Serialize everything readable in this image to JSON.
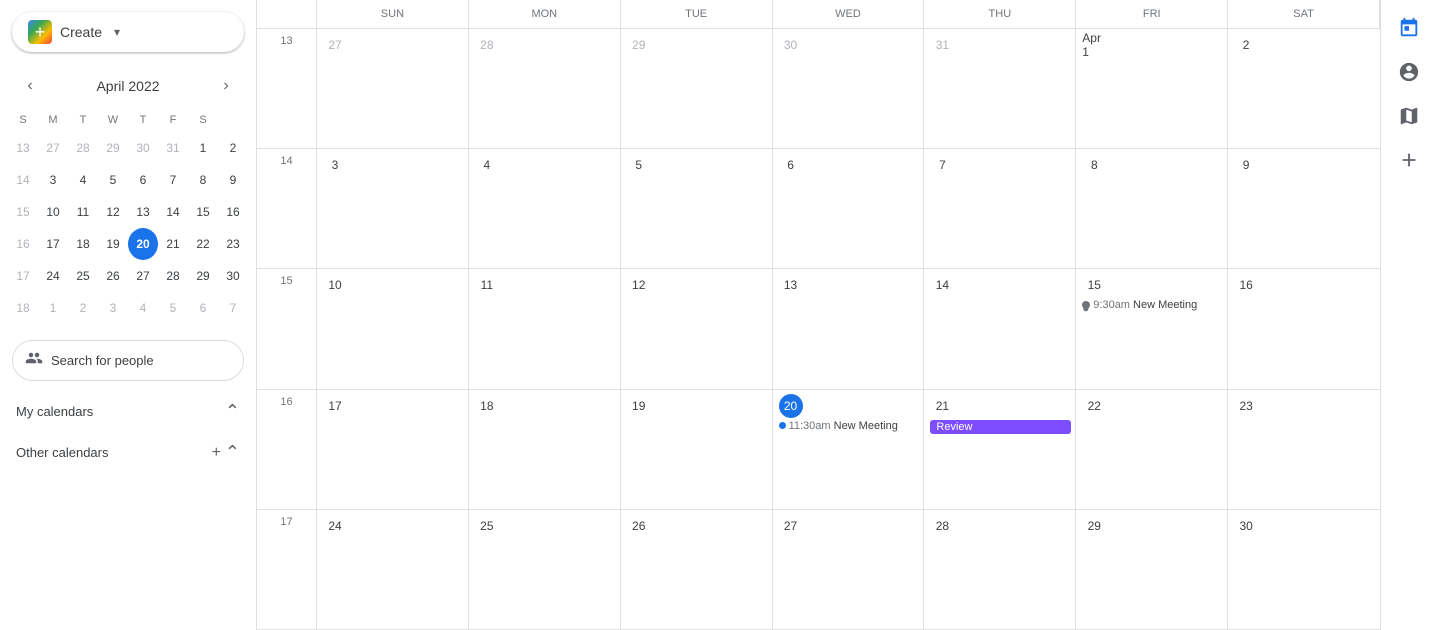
{
  "sidebar": {
    "create_button": "Create",
    "mini_cal": {
      "title": "April 2022",
      "days_of_week": [
        "S",
        "M",
        "T",
        "W",
        "T",
        "F",
        "S"
      ],
      "weeks": [
        [
          {
            "num": "13",
            "type": "other"
          },
          {
            "num": "27",
            "type": "other"
          },
          {
            "num": "28",
            "type": "other"
          },
          {
            "num": "29",
            "type": "other"
          },
          {
            "num": "30",
            "type": "other"
          },
          {
            "num": "31",
            "type": "other"
          },
          {
            "num": "1",
            "type": "normal"
          },
          {
            "num": "2",
            "type": "normal"
          }
        ],
        [
          {
            "num": "14",
            "type": "other"
          },
          {
            "num": "3",
            "type": "normal"
          },
          {
            "num": "4",
            "type": "normal"
          },
          {
            "num": "5",
            "type": "normal"
          },
          {
            "num": "6",
            "type": "normal"
          },
          {
            "num": "7",
            "type": "normal"
          },
          {
            "num": "8",
            "type": "normal"
          },
          {
            "num": "9",
            "type": "normal"
          }
        ],
        [
          {
            "num": "15",
            "type": "other"
          },
          {
            "num": "10",
            "type": "normal"
          },
          {
            "num": "11",
            "type": "normal"
          },
          {
            "num": "12",
            "type": "normal"
          },
          {
            "num": "13",
            "type": "normal"
          },
          {
            "num": "14",
            "type": "normal"
          },
          {
            "num": "15",
            "type": "normal"
          },
          {
            "num": "16",
            "type": "normal"
          }
        ],
        [
          {
            "num": "16",
            "type": "other"
          },
          {
            "num": "17",
            "type": "normal"
          },
          {
            "num": "18",
            "type": "normal"
          },
          {
            "num": "19",
            "type": "normal"
          },
          {
            "num": "20",
            "type": "today"
          },
          {
            "num": "21",
            "type": "normal"
          },
          {
            "num": "22",
            "type": "normal"
          },
          {
            "num": "23",
            "type": "normal"
          }
        ],
        [
          {
            "num": "17",
            "type": "other"
          },
          {
            "num": "24",
            "type": "normal"
          },
          {
            "num": "25",
            "type": "normal"
          },
          {
            "num": "26",
            "type": "normal"
          },
          {
            "num": "27",
            "type": "normal"
          },
          {
            "num": "28",
            "type": "normal"
          },
          {
            "num": "29",
            "type": "normal"
          },
          {
            "num": "30",
            "type": "normal"
          }
        ],
        [
          {
            "num": "18",
            "type": "other"
          },
          {
            "num": "1",
            "type": "other"
          },
          {
            "num": "2",
            "type": "other"
          },
          {
            "num": "3",
            "type": "other"
          },
          {
            "num": "4",
            "type": "other"
          },
          {
            "num": "5",
            "type": "other"
          },
          {
            "num": "6",
            "type": "other"
          },
          {
            "num": "7",
            "type": "other"
          }
        ]
      ]
    },
    "search_placeholder": "Search for people",
    "my_calendars_label": "My calendars",
    "other_calendars_label": "Other calendars"
  },
  "main_cal": {
    "header": {
      "week_num_placeholder": "",
      "days": [
        "SUN",
        "MON",
        "TUE",
        "WED",
        "THU",
        "FRI",
        "SAT"
      ]
    },
    "weeks": [
      {
        "week_num": "13",
        "days": [
          {
            "date": "27",
            "type": "other",
            "events": []
          },
          {
            "date": "28",
            "type": "other",
            "events": []
          },
          {
            "date": "29",
            "type": "other",
            "events": []
          },
          {
            "date": "30",
            "type": "other",
            "events": []
          },
          {
            "date": "31",
            "type": "other",
            "events": []
          },
          {
            "date": "Apr 1",
            "type": "special",
            "events": []
          },
          {
            "date": "2",
            "type": "normal",
            "events": []
          }
        ]
      },
      {
        "week_num": "14",
        "days": [
          {
            "date": "3",
            "type": "normal",
            "events": []
          },
          {
            "date": "4",
            "type": "normal",
            "events": []
          },
          {
            "date": "5",
            "type": "normal",
            "events": []
          },
          {
            "date": "6",
            "type": "normal",
            "events": []
          },
          {
            "date": "7",
            "type": "normal",
            "events": []
          },
          {
            "date": "8",
            "type": "normal",
            "events": []
          },
          {
            "date": "9",
            "type": "normal",
            "events": []
          }
        ]
      },
      {
        "week_num": "15",
        "days": [
          {
            "date": "10",
            "type": "normal",
            "events": []
          },
          {
            "date": "11",
            "type": "normal",
            "events": []
          },
          {
            "date": "12",
            "type": "normal",
            "events": []
          },
          {
            "date": "13",
            "type": "normal",
            "events": []
          },
          {
            "date": "14",
            "type": "normal",
            "events": []
          },
          {
            "date": "15",
            "type": "normal",
            "events": [
              {
                "type": "time",
                "time": "9:30am",
                "label": "New Meeting"
              }
            ]
          },
          {
            "date": "16",
            "type": "normal",
            "events": []
          }
        ]
      },
      {
        "week_num": "16",
        "days": [
          {
            "date": "17",
            "type": "normal",
            "events": []
          },
          {
            "date": "18",
            "type": "normal",
            "events": []
          },
          {
            "date": "19",
            "type": "normal",
            "events": []
          },
          {
            "date": "20",
            "type": "today",
            "events": [
              {
                "type": "dot",
                "time": "11:30am",
                "label": "New Meeting"
              }
            ]
          },
          {
            "date": "21",
            "type": "normal",
            "events": [
              {
                "type": "chip-purple",
                "label": "Review"
              }
            ]
          },
          {
            "date": "22",
            "type": "normal",
            "events": []
          },
          {
            "date": "23",
            "type": "normal",
            "events": []
          }
        ]
      },
      {
        "week_num": "17",
        "days": [
          {
            "date": "24",
            "type": "normal",
            "events": []
          },
          {
            "date": "25",
            "type": "normal",
            "events": []
          },
          {
            "date": "26",
            "type": "normal",
            "events": []
          },
          {
            "date": "27",
            "type": "normal",
            "events": []
          },
          {
            "date": "28",
            "type": "normal",
            "events": []
          },
          {
            "date": "29",
            "type": "normal",
            "events": []
          },
          {
            "date": "30",
            "type": "normal",
            "events": []
          }
        ]
      }
    ]
  },
  "right_sidebar": {
    "icons": [
      "calendar-check-icon",
      "account-circle-icon",
      "map-icon",
      "plus-icon"
    ]
  }
}
